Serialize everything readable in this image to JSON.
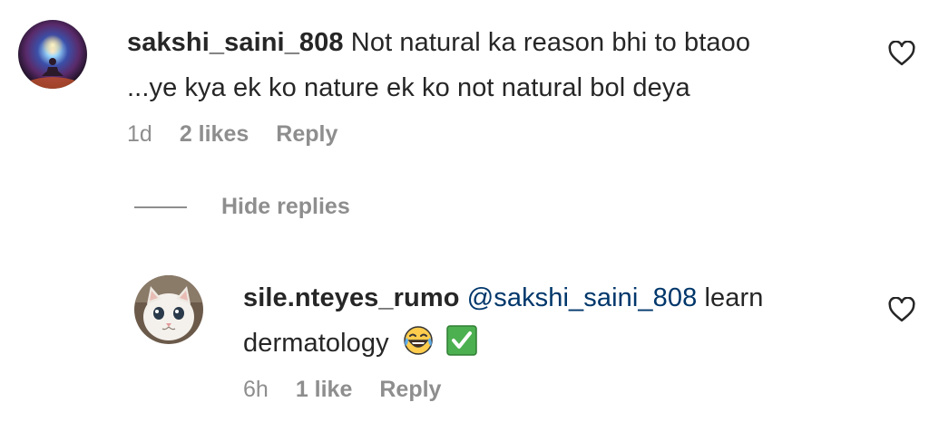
{
  "comments": [
    {
      "username": "sakshi_saini_808",
      "text": "Not natural ka reason bhi to btaoo ...ye kya ek ko nature ek ko not natural bol deya",
      "text_line1": "Not natural ka reason bhi to btaoo",
      "text_line2": "...ye kya ek ko nature ek ko not natural bol deya",
      "time": "1d",
      "likes": "2 likes",
      "reply_label": "Reply",
      "avatar_icon": "cosmic-meditation-avatar",
      "like_icon": "heart-outline-icon"
    }
  ],
  "hide_replies_label": "Hide replies",
  "replies": [
    {
      "username": "sile.nteyes_rumo",
      "mention": "@sakshi_saini_808",
      "text_after_mention": " learn",
      "text_line2": "dermatology",
      "emojis": [
        "face-with-tears-of-joy",
        "check-mark-button"
      ],
      "time": "6h",
      "likes": "1 like",
      "reply_label": "Reply",
      "avatar_icon": "white-cat-avatar",
      "like_icon": "heart-outline-icon"
    }
  ],
  "colors": {
    "text": "#262626",
    "secondary": "#8e8e8e",
    "mention": "#00376b",
    "check_green": "#4cb050"
  }
}
